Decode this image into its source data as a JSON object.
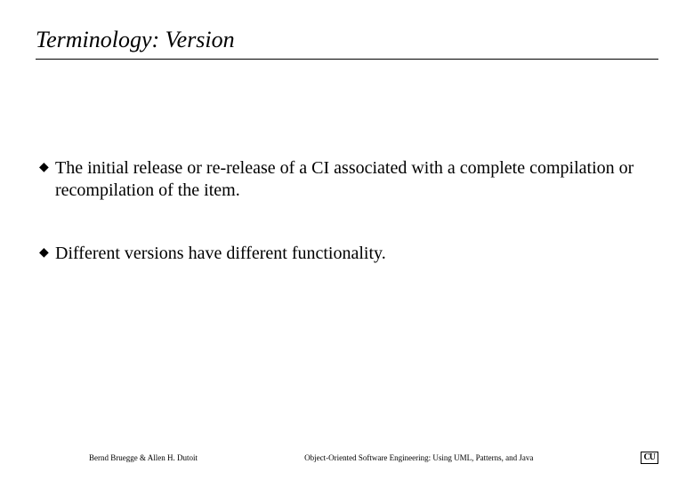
{
  "title": "Terminology: Version",
  "bullets": [
    "The initial release or re-release of a CI associated with a complete compilation or recompilation of the item.",
    "Different versions have different functionality."
  ],
  "footer": {
    "left": "Bernd Bruegge & Allen H. Dutoit",
    "center": "Object-Oriented Software Engineering: Using UML, Patterns, and Java",
    "logo": "CU"
  }
}
